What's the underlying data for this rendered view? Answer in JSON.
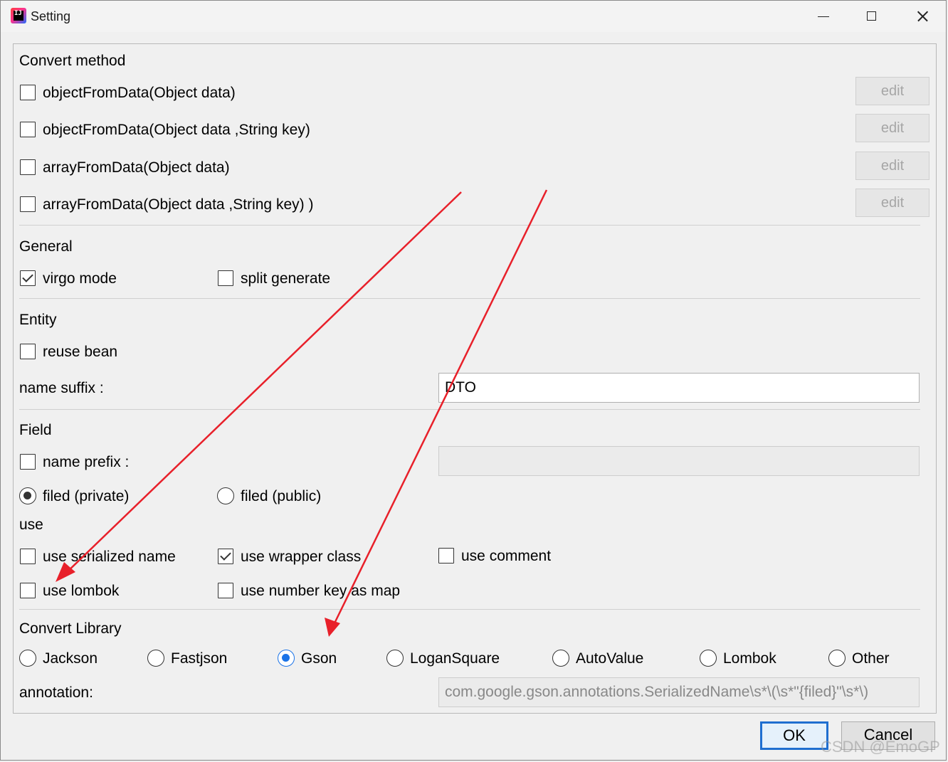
{
  "window": {
    "title": "Setting",
    "icon_text": "IJ"
  },
  "convert_method": {
    "heading": "Convert method",
    "items": [
      {
        "label": "objectFromData(Object data)",
        "checked": false,
        "edit_label": "edit"
      },
      {
        "label": "objectFromData(Object data ,String key)",
        "checked": false,
        "edit_label": "edit"
      },
      {
        "label": "arrayFromData(Object data)",
        "checked": false,
        "edit_label": "edit"
      },
      {
        "label": "arrayFromData(Object data ,String key) )",
        "checked": false,
        "edit_label": "edit"
      }
    ]
  },
  "general": {
    "heading": "General",
    "virgo_mode": {
      "label": "virgo mode",
      "checked": true
    },
    "split_generate": {
      "label": "split generate",
      "checked": false
    }
  },
  "entity": {
    "heading": "Entity",
    "reuse_bean": {
      "label": "reuse bean",
      "checked": false
    },
    "name_suffix": {
      "label": "name suffix :",
      "value": "DTO"
    }
  },
  "field": {
    "heading": "Field",
    "name_prefix": {
      "label": "name prefix :",
      "checked": false,
      "value": ""
    },
    "filed_private": {
      "label": "filed (private)",
      "selected": true
    },
    "filed_public": {
      "label": "filed (public)",
      "selected": false
    },
    "use_heading": "use",
    "use_serialized_name": {
      "label": "use serialized name",
      "checked": false
    },
    "use_wrapper_class": {
      "label": "use wrapper class",
      "checked": true
    },
    "use_comment": {
      "label": "use comment",
      "checked": false
    },
    "use_lombok": {
      "label": "use lombok",
      "checked": false
    },
    "use_number_key_as_map": {
      "label": "use number key as map",
      "checked": false
    }
  },
  "convert_library": {
    "heading": "Convert Library",
    "options": [
      {
        "label": "Jackson",
        "selected": false
      },
      {
        "label": "Fastjson",
        "selected": false
      },
      {
        "label": "Gson",
        "selected": true
      },
      {
        "label": "LoganSquare",
        "selected": false
      },
      {
        "label": "AutoValue",
        "selected": false
      },
      {
        "label": "Lombok",
        "selected": false
      },
      {
        "label": "Other",
        "selected": false
      }
    ],
    "annotation": {
      "label": "annotation:",
      "value": "com.google.gson.annotations.SerializedName\\s*\\(\\s*\"{filed}\"\\s*\\)"
    }
  },
  "buttons": {
    "ok": "OK",
    "cancel": "Cancel"
  },
  "watermark": "CSDN @EmoGP",
  "annotation_color": "#e8202a"
}
